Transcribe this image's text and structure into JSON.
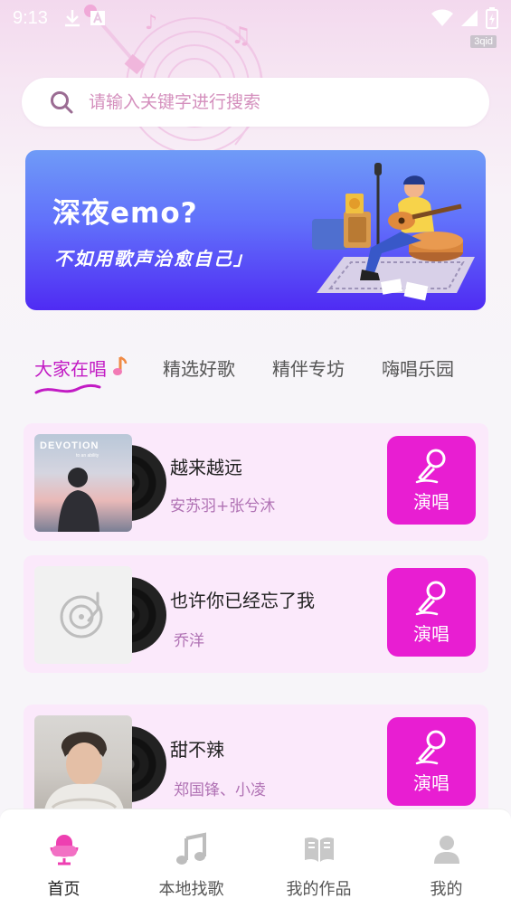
{
  "status_bar": {
    "time": "9:13",
    "tag": "3qid",
    "icons": [
      "download-icon",
      "keyboard-a-icon",
      "wifi-icon",
      "signal-icon",
      "battery-charging-icon"
    ]
  },
  "search": {
    "placeholder": "请输入关键字进行搜索"
  },
  "banner": {
    "title": "深夜emo?",
    "subtitle": "不如用歌声治愈自己」"
  },
  "tabs": [
    {
      "label": "大家在唱",
      "active": true
    },
    {
      "label": "精选好歌",
      "active": false
    },
    {
      "label": "精伴专坊",
      "active": false
    },
    {
      "label": "嗨唱乐园",
      "active": false
    }
  ],
  "songs": [
    {
      "title": "越来越远",
      "artist": "安苏羽+张兮沐",
      "button": "演唱",
      "cover_text": "DEVOTION",
      "cover_subtext": "to an ability"
    },
    {
      "title": "也许你已经忘了我",
      "artist": "乔洋",
      "button": "演唱"
    },
    {
      "title": "甜不辣",
      "artist": "郑国锋、小凌",
      "button": "演唱"
    }
  ],
  "bottom_nav": [
    {
      "label": "首页",
      "icon": "microphone-icon",
      "active": true
    },
    {
      "label": "本地找歌",
      "icon": "music-note-icon",
      "active": false
    },
    {
      "label": "我的作品",
      "icon": "book-icon",
      "active": false
    },
    {
      "label": "我的",
      "icon": "user-icon",
      "active": false
    }
  ],
  "colors": {
    "accent": "#e81ed2",
    "tab_active": "#c21bc4",
    "artist_text": "#b072b4",
    "card_bg": "#fbe9fb"
  }
}
